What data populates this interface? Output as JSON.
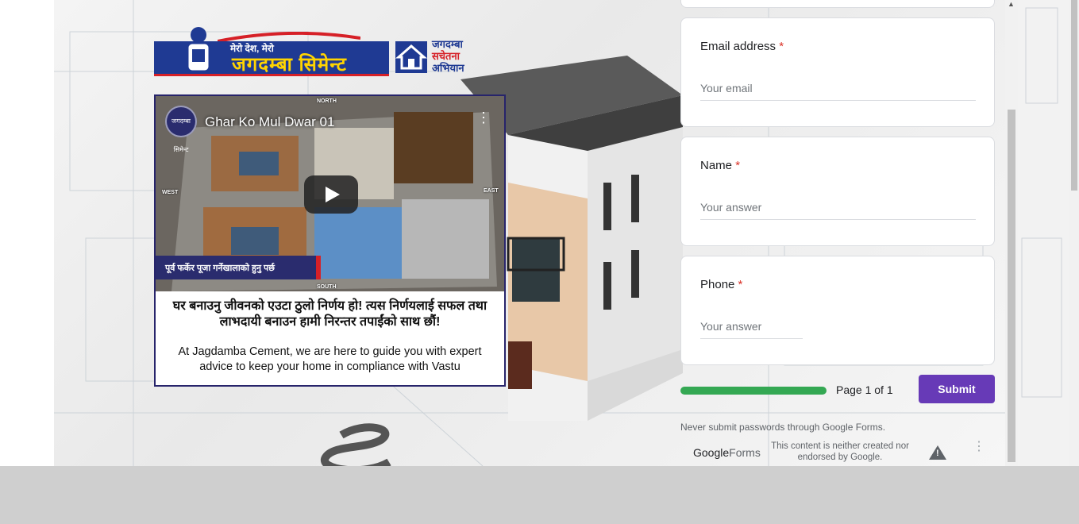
{
  "logo": {
    "tagline": "मेरो देश, मेरो",
    "brand": "जगदम्बा सिमेन्ट",
    "campaign_lines": [
      "जगदम्बा",
      "सचेतना",
      "अभियान"
    ]
  },
  "video": {
    "title": "Ghar Ko Mul Dwar 01",
    "channel_avatar_text": "जगदम्बा सिमेन्ट",
    "compass": {
      "north": "NORTH",
      "south": "SOUTH",
      "east": "EAST",
      "west": "WEST"
    },
    "overlay_caption": "पूर्व फर्केर पूजा गर्नेखालाको हुनु पर्छ",
    "nepali_text": "घर बनाउनु जीवनको एउटा ठुलो निर्णय हो! त्यस निर्णयलाई सफल तथा लाभदायी बनाउन हामी निरन्तर तपाईंको साथ छौं!",
    "english_text": "At Jagdamba Cement, we are here to guide you with expert advice to keep your home in compliance with Vastu"
  },
  "form": {
    "questions": [
      {
        "label": "Email address",
        "required_mark": "*",
        "placeholder": "Your email"
      },
      {
        "label": "Name",
        "required_mark": "*",
        "placeholder": "Your answer"
      },
      {
        "label": "Phone",
        "required_mark": "*",
        "placeholder": "Your answer"
      }
    ],
    "progress": 1.0,
    "page_text": "Page 1 of 1",
    "submit_label": "Submit",
    "never_submit": "Never submit passwords through Google Forms.",
    "footer": {
      "google": "Google",
      "forms": "Forms",
      "disclaimer": "This content is neither created nor endorsed by Google."
    }
  },
  "colors": {
    "accent": "#673ab7",
    "progress": "#34a853",
    "required": "#d93025",
    "brand_blue": "#1f3a93",
    "brand_red": "#d62027"
  }
}
